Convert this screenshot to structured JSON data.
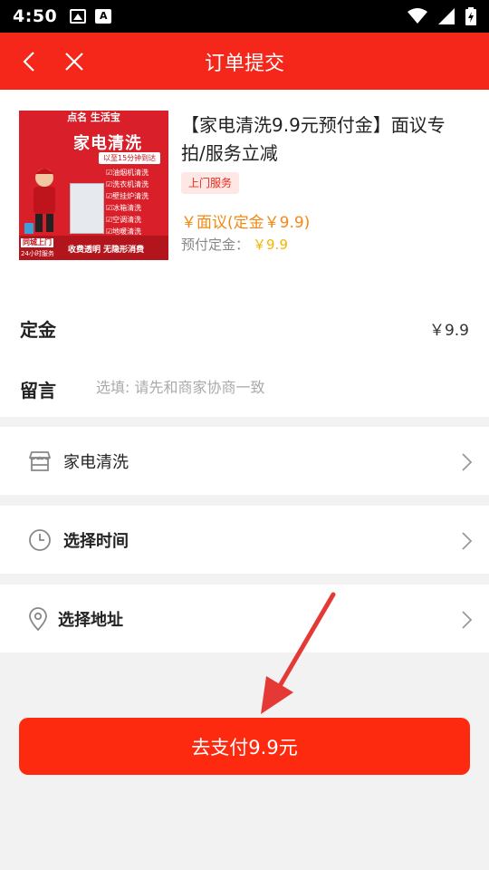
{
  "status_bar": {
    "time": "4:50"
  },
  "nav": {
    "title": "订单提交"
  },
  "product": {
    "title": "【家电清洗9.9元预付金】面议专拍/服务立减",
    "tag": "上门服务",
    "price": "￥面议(定金￥9.9)",
    "deposit_label": "预付定金：",
    "deposit_value": "￥9.9",
    "image": {
      "top_text": "点名 生活宝",
      "title": "家电清洗",
      "subtitle": "以至15分钟到达",
      "services": [
        "☑油烟机清洗",
        "☑洗衣机清洗",
        "☑壁挂炉清洗",
        "☑冰箱清洗",
        "☑空调清洗",
        "☑地暖清洗"
      ],
      "bottom_tag": "同城上门",
      "bottom_24": "24小时服务",
      "bottom_text": "收费透明  无隐形消费"
    }
  },
  "deposit_row": {
    "label": "定金",
    "value": "￥9.9"
  },
  "message_row": {
    "label": "留言",
    "placeholder": "选填: 请先和商家协商一致"
  },
  "options": {
    "service": {
      "label": "家电清洗",
      "icon": "store-icon"
    },
    "time": {
      "label": "选择时间",
      "icon": "clock-icon"
    },
    "address": {
      "label": "选择地址",
      "icon": "location-pin-icon"
    }
  },
  "pay_button": {
    "label": "去支付9.9元"
  },
  "colors": {
    "primary": "#f5261a",
    "button": "#fe2a0f",
    "price": "#f08a14",
    "deposit": "#f5b400",
    "arrow": "#e53935"
  }
}
